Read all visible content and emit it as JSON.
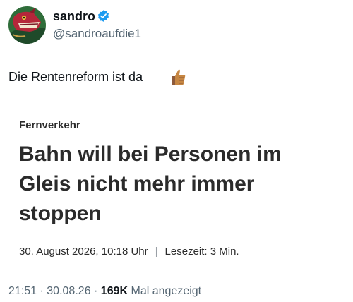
{
  "author": {
    "display_name": "sandro",
    "handle": "@sandroaufdie1",
    "verified": true,
    "avatar_icon": "dragon-avatar-icon"
  },
  "tweet": {
    "text": "Die Rentenreform ist da",
    "emoji_icon": "thumbs-up-icon"
  },
  "article": {
    "kicker": "Fernverkehr",
    "headline": "Bahn will bei Personen im Gleis nicht mehr immer stoppen",
    "date": "30. August 2026, 10:18 Uhr",
    "separator": "|",
    "reading_time": "Lesezeit: 3 Min."
  },
  "footer": {
    "time": "21:51",
    "dot1": "·",
    "date": "30.08.26",
    "dot2": "·",
    "views": "169K",
    "views_label": "Mal angezeigt"
  },
  "colors": {
    "verified": "#1d9bf0",
    "secondary_text": "#536471"
  }
}
